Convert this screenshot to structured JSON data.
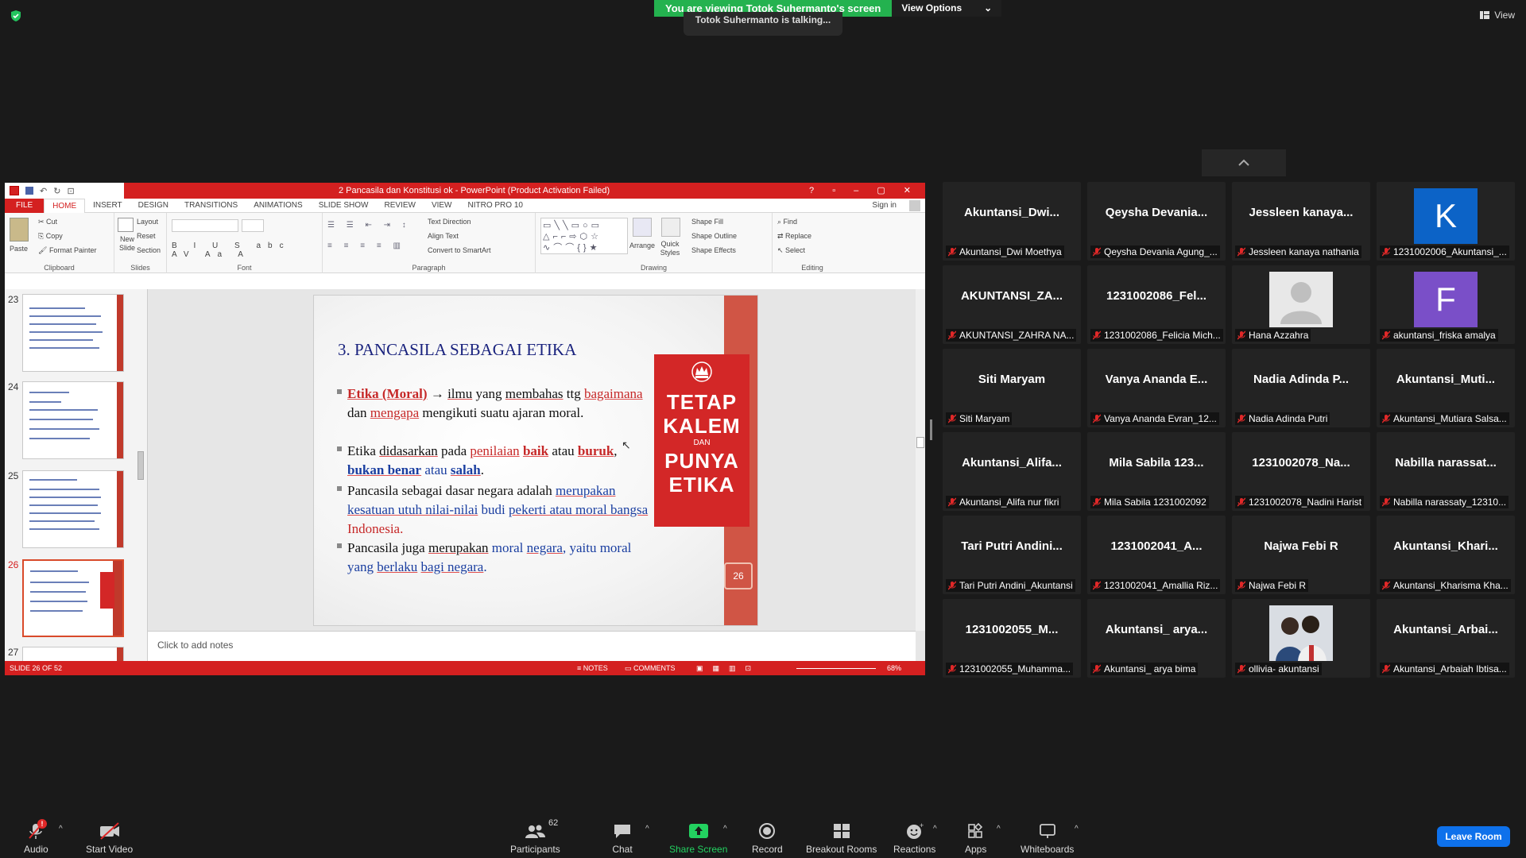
{
  "banner": {
    "viewing": "You are viewing Totok Suhermanto's screen",
    "view_options": "View Options",
    "talking": "Totok Suhermanto is talking..."
  },
  "top_right": {
    "view": "View"
  },
  "ppt": {
    "title": "2 Pancasila dan Konstitusi ok -  PowerPoint (Product Activation Failed)",
    "tabs": [
      "FILE",
      "HOME",
      "INSERT",
      "DESIGN",
      "TRANSITIONS",
      "ANIMATIONS",
      "SLIDE SHOW",
      "REVIEW",
      "VIEW",
      "NITRO PRO 10"
    ],
    "sign_in": "Sign in",
    "ribbon": {
      "clipboard": {
        "label": "Clipboard",
        "paste": "Paste",
        "cut": "Cut",
        "copy": "Copy",
        "format_painter": "Format Painter"
      },
      "slides": {
        "label": "Slides",
        "new_slide": "New Slide",
        "layout": "Layout",
        "reset": "Reset",
        "section": "Section"
      },
      "font": {
        "label": "Font"
      },
      "paragraph": {
        "label": "Paragraph",
        "text_direction": "Text Direction",
        "align_text": "Align Text",
        "convert": "Convert to SmartArt"
      },
      "drawing": {
        "label": "Drawing",
        "arrange": "Arrange",
        "quick_styles": "Quick Styles",
        "shape_fill": "Shape Fill",
        "shape_outline": "Shape Outline",
        "shape_effects": "Shape Effects"
      },
      "editing": {
        "label": "Editing",
        "find": "Find",
        "replace": "Replace",
        "select": "Select"
      }
    },
    "thumb_numbers": [
      "23",
      "24",
      "25",
      "26",
      "27"
    ],
    "slide": {
      "title": "3. PANCASILA SEBAGAI ETIKA",
      "b1": {
        "a": "Etika (Moral)",
        "arrow": " → ",
        "b": "ilmu",
        "c": " yang ",
        "d": "membahas",
        "e": " ttg ",
        "f": "bagaimana",
        "g": " dan ",
        "h": "mengapa",
        "i": "  mengikuti suatu ajaran moral."
      },
      "b2": {
        "a": "Etika ",
        "b": "didasarkan",
        "c": " pada ",
        "d": "penilaian",
        "e": " ",
        "f": "baik",
        "g": " atau ",
        "h": "buruk",
        "i": ", ",
        "j": "bukan benar",
        "k": " atau ",
        "l": "salah",
        "m": "."
      },
      "b3": {
        "a": "Pancasila sebagai dasar negara adalah ",
        "b": "merupakan kesatuan utuh nilai-nilai",
        "c": " budi ",
        "d": "pekerti atau moral bangsa",
        "e": " Indonesia."
      },
      "b4": {
        "a": "Pancasila juga ",
        "b": "merupakan",
        "c": " moral ",
        "d": "negara",
        "e": ", yaitu moral yang ",
        "f": "berlaku",
        "g": " ",
        "h": "bagi negara",
        "i": "."
      },
      "poster": {
        "l1": "TETAP",
        "l2": "KALEM",
        "l3": "DAN",
        "l4": "PUNYA",
        "l5": "ETIKA"
      },
      "page": "26"
    },
    "notes": "Click to add notes",
    "status": {
      "slide": "SLIDE 26 OF 52",
      "notes": "NOTES",
      "comments": "COMMENTS",
      "zoom": "68%"
    }
  },
  "participants": [
    {
      "name": "Akuntansi_Dwi...",
      "label": "Akuntansi_Dwi Moethya"
    },
    {
      "name": "Qeysha  Devania...",
      "label": "Qeysha Devania Agung_..."
    },
    {
      "name": "Jessleen  kanaya...",
      "label": "Jessleen kanaya nathania"
    },
    {
      "name": "K",
      "label": "1231002006_Akuntansi_...",
      "avatar": "K",
      "color": "#0c63c7"
    },
    {
      "name": "AKUNTANSI_ZA...",
      "label": "AKUNTANSI_ZAHRA NA..."
    },
    {
      "name": "1231002086_Fel...",
      "label": "1231002086_Felicia Mich..."
    },
    {
      "name": "",
      "label": "Hana Azzahra",
      "photo": "person"
    },
    {
      "name": "F",
      "label": "akuntansi_friska amalya",
      "avatar": "F",
      "color": "#7a4fc8"
    },
    {
      "name": "Siti Maryam",
      "label": "Siti Maryam"
    },
    {
      "name": "Vanya Ananda E...",
      "label": "Vanya Ananda Evran_12..."
    },
    {
      "name": "Nadia Adinda P...",
      "label": "Nadia Adinda Putri"
    },
    {
      "name": "Akuntansi_Muti...",
      "label": "Akuntansi_Mutiara Salsa..."
    },
    {
      "name": "Akuntansi_Alifa...",
      "label": "Akuntansi_Alifa nur fikri"
    },
    {
      "name": "Mila Sabila 123...",
      "label": "Mila Sabila 1231002092"
    },
    {
      "name": "1231002078_Na...",
      "label": "1231002078_Nadini Harist"
    },
    {
      "name": "Nabilla  narassat...",
      "label": "Nabilla narassaty_12310..."
    },
    {
      "name": "Tari Putri Andini...",
      "label": "Tari Putri Andini_Akuntansi"
    },
    {
      "name": "1231002041_A...",
      "label": "1231002041_Amallia Riz..."
    },
    {
      "name": "Najwa Febi R",
      "label": "Najwa Febi R"
    },
    {
      "name": "Akuntansi_Khari...",
      "label": "Akuntansi_Kharisma Kha..."
    },
    {
      "name": "1231002055_M...",
      "label": "1231002055_Muhamma..."
    },
    {
      "name": "Akuntansi_  arya...",
      "label": "Akuntansi_ arya bima"
    },
    {
      "name": "",
      "label": "ollivia- akuntansi",
      "photo": "selfie"
    },
    {
      "name": "Akuntansi_Arbai...",
      "label": "Akuntansi_Arbaiah Ibtisa..."
    }
  ],
  "toolbar": {
    "audio": "Audio",
    "start_video": "Start Video",
    "participants": "Participants",
    "participants_count": "62",
    "chat": "Chat",
    "share_screen": "Share Screen",
    "record": "Record",
    "breakout": "Breakout Rooms",
    "reactions": "Reactions",
    "apps": "Apps",
    "whiteboards": "Whiteboards",
    "leave": "Leave Room",
    "audio_badge": "!"
  }
}
